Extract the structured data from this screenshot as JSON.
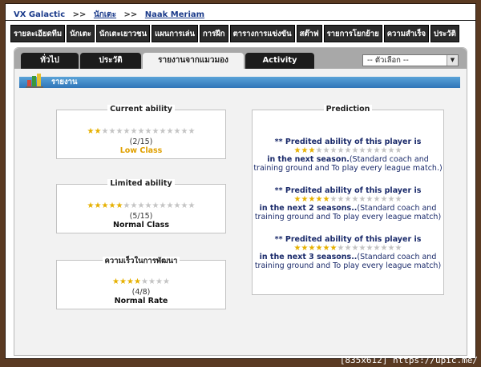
{
  "breadcrumb": {
    "home": "VX Galactic",
    "sep1": ">>",
    "players": "นักเตะ",
    "sep2": ">>",
    "player": "Naak Meriam"
  },
  "nav": [
    "รายละเอียดทีม",
    "นักเตะ",
    "นักเตะเยาวชน",
    "แผนการเล่น",
    "การฝึก",
    "ตารางการแข่งขัน",
    "สต๊าฟ",
    "รายการโยกย้าย",
    "ความสำเร็จ",
    "ประวัติ"
  ],
  "tabs": [
    "ทั่วไป",
    "ประวัติ",
    "รายงานจากแมวมอง",
    "Activity"
  ],
  "active_tab": 2,
  "select": {
    "value": "-- ตัวเลือก --"
  },
  "section": {
    "label": "รายงาน"
  },
  "current": {
    "title": "Current ability",
    "filled": 2,
    "total": 15,
    "count": "(2/15)",
    "class": "Low Class",
    "color": "#e0a000"
  },
  "limited": {
    "title": "Limited ability",
    "filled": 5,
    "total": 15,
    "count": "(5/15)",
    "class": "Normal Class",
    "color": "#111111"
  },
  "rate": {
    "title": "ความเร็วในการพัฒนา",
    "filled": 4,
    "total": 8,
    "count": "(4/8)",
    "class": "Normal Rate",
    "color": "#111111"
  },
  "prediction": {
    "title": "Prediction",
    "items": [
      {
        "head": "** Predited ability of this player is",
        "filled": 3,
        "total": 15,
        "when": "in the next season.",
        "note": "(Standard coach and",
        "note2": "training ground and To play every league match.)"
      },
      {
        "head": "** Predited ability of this player is",
        "filled": 5,
        "total": 15,
        "when": "in the next 2 seasons..",
        "note": "(Standard coach and",
        "note2": "training ground and To play every league match)"
      },
      {
        "head": "** Predited ability of this player is",
        "filled": 6,
        "total": 15,
        "when": "in the next 3 seasons..",
        "note": "(Standard coach and",
        "note2": "training ground and To play every league match)"
      }
    ]
  },
  "watermark": "[835x612] https://upic.me/"
}
